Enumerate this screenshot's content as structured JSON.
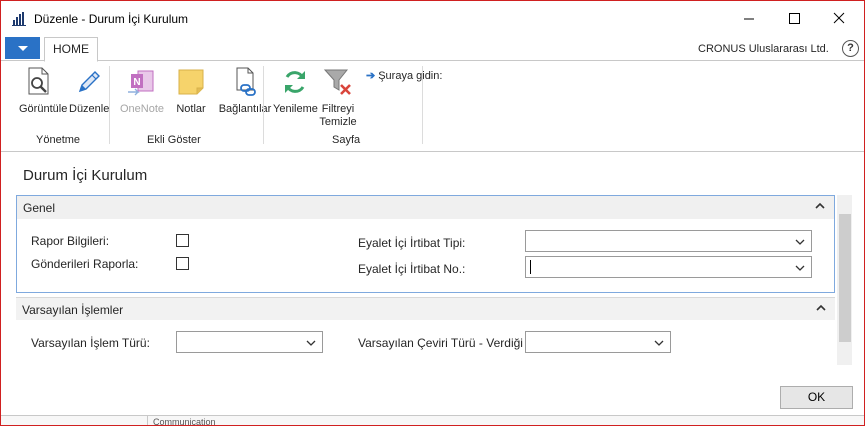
{
  "window": {
    "title": "Düzenle - Durum İçi Kurulum",
    "controls": [
      "minimize-icon",
      "maximize-icon",
      "close-icon"
    ]
  },
  "ribbon": {
    "tab": "HOME",
    "company": "CRONUS Uluslararası Ltd.",
    "help": "?",
    "groups": {
      "yonetme": "Yönetme",
      "ekli": "Ekli Göster",
      "sayfa": "Sayfa"
    },
    "buttons": {
      "view": "Görüntüle",
      "edit": "Düzenle",
      "onenote": "OneNote",
      "notes": "Notlar",
      "links": "Bağlantılar",
      "refresh": "Yenileme",
      "clear_filter_1": "Filtreyi",
      "clear_filter_2": "Temizle"
    },
    "goto": "Şuraya gidin:",
    "colors": {
      "accent": "#2a72c6",
      "onenote": "#c16fc1",
      "notes": "#f6d36b",
      "refresh": "#3aa56a",
      "clear_x": "#d9453b"
    }
  },
  "page": {
    "title": "Durum İçi Kurulum",
    "sections": {
      "genel": {
        "title": "Genel",
        "rapor_bilgileri": "Rapor Bilgileri:",
        "gonderileri_raporla": "Gönderileri Raporla:",
        "eyalet_tipi": "Eyalet İçi İrtibat Tipi:",
        "eyalet_no": "Eyalet İçi İrtibat No.:",
        "eyalet_tipi_value": "",
        "eyalet_no_value": ""
      },
      "varsayilan": {
        "title": "Varsayılan İşlemler",
        "islem_turu": "Varsayılan İşlem Türü:",
        "ceviri_turu": "Varsayılan Çeviri Türü - Verdiği Değer:",
        "islem_turu_value": "",
        "ceviri_turu_value": ""
      }
    },
    "ok": "OK",
    "background_tab": "Communication"
  }
}
